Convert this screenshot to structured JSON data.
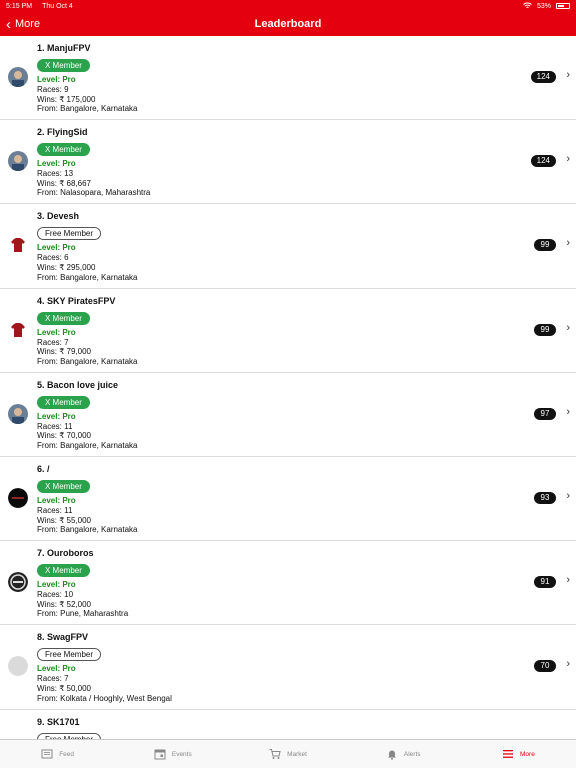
{
  "status_bar": {
    "time": "5:15 PM",
    "date": "Thu Oct 4",
    "battery": "53%"
  },
  "nav": {
    "back_label": "More",
    "title": "Leaderboard"
  },
  "colors": {
    "brand_red": "#e4000e",
    "member_green": "#2ba24c",
    "level_green": "#1a8a1a"
  },
  "entries": [
    {
      "rank_name": "1. ManjuFPV",
      "membership": "X Member",
      "member_type": "x",
      "level": "Level: Pro",
      "races": "Races: 9",
      "wins": "Wins: ₹ 175,000",
      "from": "From: Bangalore, Karnataka",
      "score": "124",
      "avatar": "photo-avatar"
    },
    {
      "rank_name": "2. FlyingSid",
      "membership": "X Member",
      "member_type": "x",
      "level": "Level: Pro",
      "races": "Races: 13",
      "wins": "Wins: ₹ 68,667",
      "from": "From: Nalasopara, Maharashtra",
      "score": "124",
      "avatar": "photo-avatar"
    },
    {
      "rank_name": "3. Devesh",
      "membership": "Free Member",
      "member_type": "free",
      "level": "Level: Pro",
      "races": "Races: 6",
      "wins": "Wins: ₹ 295,000",
      "from": "From: Bangalore, Karnataka",
      "score": "99",
      "avatar": "tshirt-icon"
    },
    {
      "rank_name": "4. SKY PiratesFPV",
      "membership": "X Member",
      "member_type": "x",
      "level": "Level: Pro",
      "races": "Races: 7",
      "wins": "Wins: ₹ 79,000",
      "from": "From: Bangalore, Karnataka",
      "score": "99",
      "avatar": "tshirt-icon"
    },
    {
      "rank_name": "5. Bacon love juice",
      "membership": "X Member",
      "member_type": "x",
      "level": "Level: Pro",
      "races": "Races: 11",
      "wins": "Wins: ₹ 70,000",
      "from": "From: Bangalore, Karnataka",
      "score": "97",
      "avatar": "photo-avatar"
    },
    {
      "rank_name": "6. /",
      "membership": "X Member",
      "member_type": "x",
      "level": "Level: Pro",
      "races": "Races: 11",
      "wins": "Wins: ₹ 55,000",
      "from": "From: Bangalore, Karnataka",
      "score": "93",
      "avatar": "dark-logo-avatar"
    },
    {
      "rank_name": "7. Ouroboros",
      "membership": "X Member",
      "member_type": "x",
      "level": "Level: Pro",
      "races": "Races: 10",
      "wins": "Wins: ₹ 52,000",
      "from": "From: Pune, Maharashtra",
      "score": "91",
      "avatar": "emblem-avatar"
    },
    {
      "rank_name": "8. SwagFPV",
      "membership": "Free Member",
      "member_type": "free",
      "level": "Level: Pro",
      "races": "Races: 7",
      "wins": "Wins: ₹ 50,000",
      "from": "From: Kolkata / Hooghly, West Bengal",
      "score": "70",
      "avatar": "placeholder-avatar"
    },
    {
      "rank_name": "9. SK1701",
      "membership": "Free Member",
      "member_type": "free",
      "level": "",
      "races": "",
      "wins": "",
      "from": "",
      "score": "",
      "avatar": "placeholder-avatar"
    }
  ],
  "tabs": [
    {
      "label": "Feed",
      "icon": "feed-icon",
      "active": false
    },
    {
      "label": "Events",
      "icon": "calendar-icon",
      "active": false
    },
    {
      "label": "Market",
      "icon": "cart-icon",
      "active": false
    },
    {
      "label": "Alerts",
      "icon": "bell-icon",
      "active": false
    },
    {
      "label": "More",
      "icon": "menu-icon",
      "active": true
    }
  ]
}
